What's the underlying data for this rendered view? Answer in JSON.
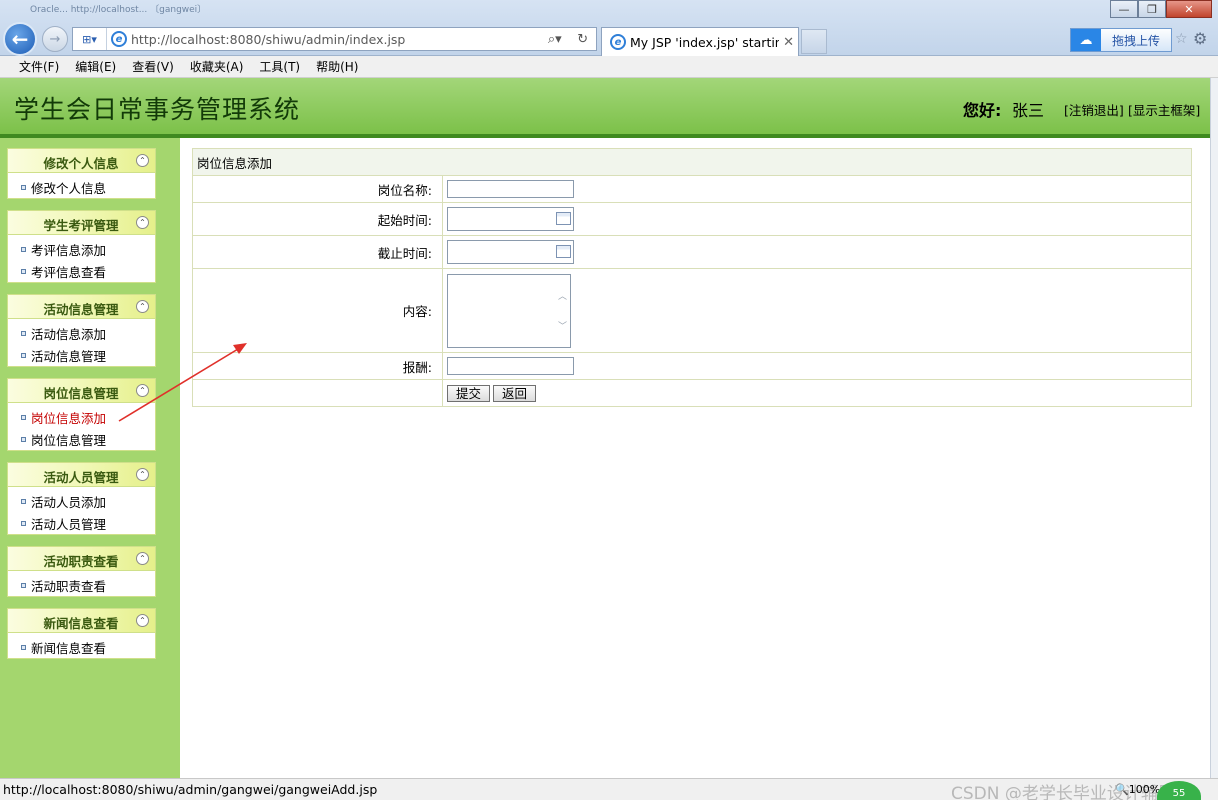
{
  "browser": {
    "window_title": "Oracle... http://localhost... 〔gangwei〕",
    "window_buttons": [
      "—",
      "❐",
      "✕"
    ],
    "back_glyph": "←",
    "forward_glyph": "→",
    "compat_glyph": "⊞▾",
    "url": "http://localhost:8080/shiwu/admin/index.jsp",
    "address_tools": [
      "⌕▾",
      "↻"
    ],
    "tab_title": "My JSP 'index.jsp' startin...",
    "tab_close": "✕",
    "upload_label": "拖拽上传",
    "menu": [
      "文件(F)",
      "编辑(E)",
      "查看(V)",
      "收藏夹(A)",
      "工具(T)",
      "帮助(H)"
    ]
  },
  "header": {
    "title": "学生会日常事务管理系统",
    "greeting": "您好:",
    "user": "张三",
    "logout": "[注销退出]",
    "show_frame": "[显示主框架]"
  },
  "sidebar": {
    "groups": [
      {
        "title": "修改个人信息",
        "items": [
          "修改个人信息"
        ]
      },
      {
        "title": "学生考评管理",
        "items": [
          "考评信息添加",
          "考评信息查看"
        ]
      },
      {
        "title": "活动信息管理",
        "items": [
          "活动信息添加",
          "活动信息管理"
        ]
      },
      {
        "title": "岗位信息管理",
        "items": [
          "岗位信息添加",
          "岗位信息管理"
        ]
      },
      {
        "title": "活动人员管理",
        "items": [
          "活动人员添加",
          "活动人员管理"
        ]
      },
      {
        "title": "活动职责查看",
        "items": [
          "活动职责查看"
        ]
      },
      {
        "title": "新闻信息查看",
        "items": [
          "新闻信息查看"
        ]
      }
    ],
    "collapse_glyph": "⌃",
    "active_item": "岗位信息添加"
  },
  "form": {
    "caption": "岗位信息添加",
    "fields": {
      "name_label": "岗位名称:",
      "start_label": "起始时间:",
      "end_label": "截止时间:",
      "content_label": "内容:",
      "pay_label": "报酬:"
    },
    "values": {
      "name": "",
      "start": "",
      "end": "",
      "content": "",
      "pay": ""
    },
    "submit": "提交",
    "back": "返回"
  },
  "status": {
    "url": "http://localhost:8080/shiwu/admin/gangwei/gangweiAdd.jsp",
    "watermark": "CSDN @老学长毕业设计辅导",
    "zoom": "🔍100%",
    "badge": "55"
  },
  "colors": {
    "header_green": "#7cc149",
    "sidebar_green": "#a4d66e",
    "active_red": "#c40000",
    "arrow_red": "#e0302a"
  }
}
